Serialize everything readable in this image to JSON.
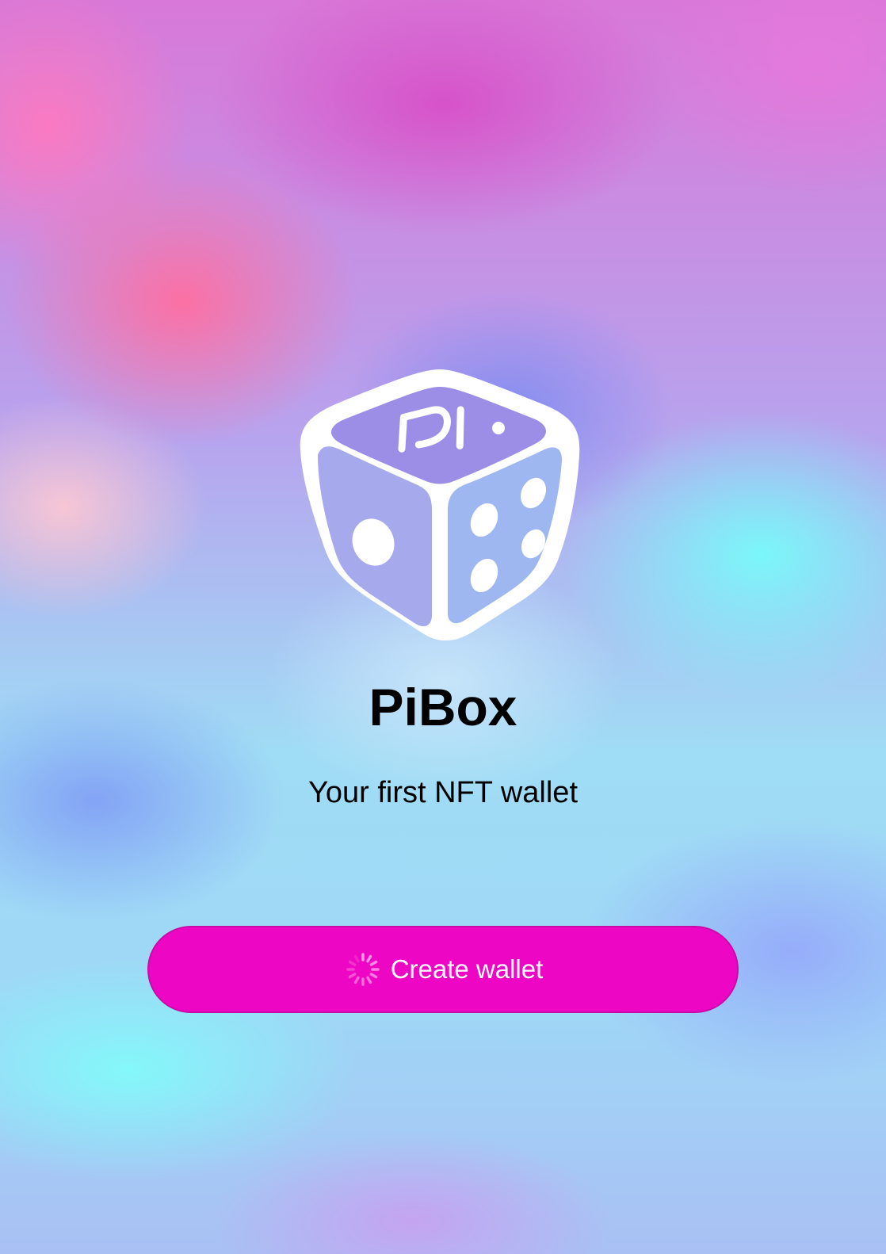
{
  "app": {
    "name": "PiBox",
    "tagline": "Your first NFT wallet",
    "logo_icon": "pi-dice-icon",
    "logo_glyph": "pi"
  },
  "actions": {
    "create_wallet_label": "Create wallet",
    "create_wallet_icon": "loading-spinner-icon"
  },
  "colors": {
    "accent": "#ed07c4",
    "text": "#000000",
    "button_text": "#ffffff"
  }
}
